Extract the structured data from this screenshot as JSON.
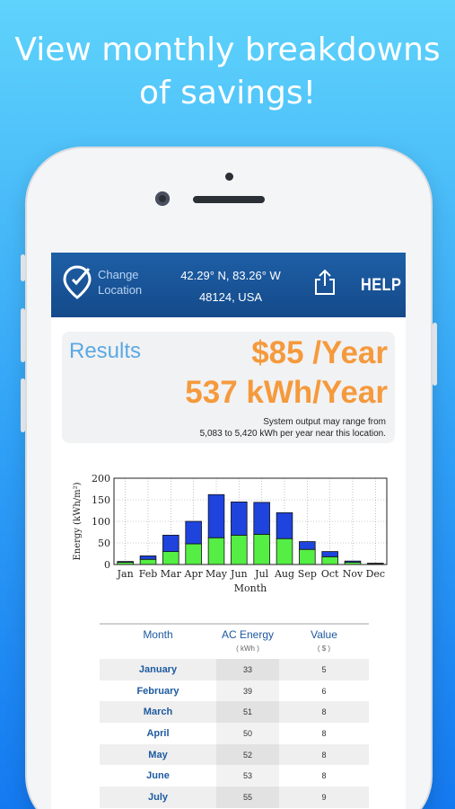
{
  "headline": "View monthly breakdowns of savings!",
  "appbar": {
    "change_location": "Change Location",
    "coords": "42.29° N, 83.26° W",
    "zip": "48124, USA",
    "help": "HELP"
  },
  "results": {
    "label": "Results",
    "money": "$85 /Year",
    "kwh": "537 kWh/Year",
    "range_line1": "System output may range from",
    "range_line2": "5,083 to 5,420 kWh per year near this location."
  },
  "chart_data": {
    "type": "bar",
    "stacked": true,
    "categories": [
      "Jan",
      "Feb",
      "Mar",
      "Apr",
      "May",
      "Jun",
      "Jul",
      "Aug",
      "Sep",
      "Oct",
      "Nov",
      "Dec"
    ],
    "series": [
      {
        "name": "",
        "color": "#55ee44",
        "values": [
          5,
          12,
          30,
          48,
          62,
          68,
          70,
          60,
          35,
          18,
          5,
          2
        ]
      },
      {
        "name": "",
        "color": "#1e44dd",
        "values": [
          2,
          8,
          38,
          52,
          100,
          77,
          74,
          60,
          18,
          12,
          3,
          1
        ]
      }
    ],
    "ylabel": "Energy (kWh/m²)",
    "xlabel": "Month",
    "ylim": [
      0,
      200
    ],
    "yticks": [
      0,
      50,
      100,
      150,
      200
    ],
    "grid": true
  },
  "table": {
    "headers": [
      "Month",
      "AC Energy",
      "Value"
    ],
    "units": [
      "",
      "( kWh )",
      "( $ )"
    ],
    "rows": [
      [
        "January",
        "33",
        "5"
      ],
      [
        "February",
        "39",
        "6"
      ],
      [
        "March",
        "51",
        "8"
      ],
      [
        "April",
        "50",
        "8"
      ],
      [
        "May",
        "52",
        "8"
      ],
      [
        "June",
        "53",
        "8"
      ],
      [
        "July",
        "55",
        "9"
      ]
    ]
  }
}
